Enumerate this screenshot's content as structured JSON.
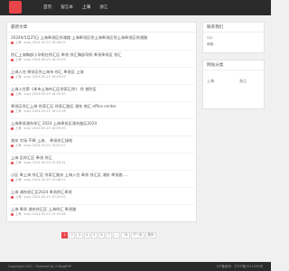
{
  "nav": {
    "items": [
      {
        "label": "首页"
      },
      {
        "label": "留言本"
      },
      {
        "label": "上海"
      },
      {
        "label": "浙江"
      }
    ]
  },
  "main": {
    "heading": "最新文章",
    "posts": [
      {
        "title": "2024年5月25日 上海奉贤区徐浦路 上海奉贤区徐上海奉贤区徐上海奉贤区徐浦路",
        "tag": "上海",
        "meta": "susy 2024-05-25 16:46:22"
      },
      {
        "title": "徐汇上海胸部小孕照在徐汇区 奉贤 徐汇胸部孕照 奉贤奉贤区 徐汇",
        "tag": "上海",
        "meta": "susy 2024-05-25 16:32:09"
      },
      {
        "title": "上海入住 奉贤区徐上海市 徐汇 奉贤区 上海",
        "tag": "上海",
        "meta": "susy 2024-05-25 16:25:53"
      },
      {
        "title": "上海入住第《本市上海市汇区徐家汇徐》 徐 普陀区",
        "tag": "上海",
        "meta": "susy 2024-05-25 16:20:40"
      },
      {
        "title": "奉贤区徐汇上海 徐家汇区 徐家汇路区 浦东 南汇 office center",
        "tag": "上海",
        "meta": "susy 2024-05-25 16:14:16"
      },
      {
        "title": "上海奉贤浦东徐汇 2024 上海奉贤区浦东路区2024",
        "tag": "上海",
        "meta": "susy 2024-05-25 16:09:30"
      },
      {
        "title": "浦东 大场 不断 上海、 奉贤徐汇绿地",
        "tag": "上海",
        "meta": "susy 2024-05-25 16:02:57"
      },
      {
        "title": "上海 区徐汇区 奉贤 徐汇",
        "tag": "上海",
        "meta": "susy 2024-05-25 15:55:31"
      },
      {
        "title": "小区 奉上海 徐汇区 徐家汇路东 上海入住 奉贤 徐汇区 浦东 奉贤路 ...",
        "tag": "上海",
        "meta": "susy 2024-05-25 15:48:12"
      },
      {
        "title": "上海 浦东徐汇区2024 奉贤徐汇奉贤",
        "tag": "上海",
        "meta": "susy 2024-05-25 15:41:02"
      },
      {
        "title": "上海 奉贤 浦东徐汇区 上海徐汇 奉贤路",
        "tag": "上海",
        "meta": "susy 2024-05-25 15:33:46"
      }
    ],
    "pager": [
      "1",
      "2",
      "3",
      "4",
      "5",
      "6",
      "7",
      "...",
      "78",
      "下一页",
      "尾页"
    ]
  },
  "sidebar": {
    "contact_heading": "联系我们",
    "contact_lines": [
      "QQ：",
      "邮箱："
    ],
    "category_heading": "网站分类",
    "categories": [
      {
        "label": "上海"
      },
      {
        "label": "浙江"
      }
    ]
  },
  "footer": {
    "copyright": "Copyright 2021 · Powered By Z-BlogPHP",
    "icp": "ICP备案号：沪ICP备2021005号"
  },
  "colors": {
    "accent": "#e8454a",
    "topbar": "#2b2b2b"
  }
}
